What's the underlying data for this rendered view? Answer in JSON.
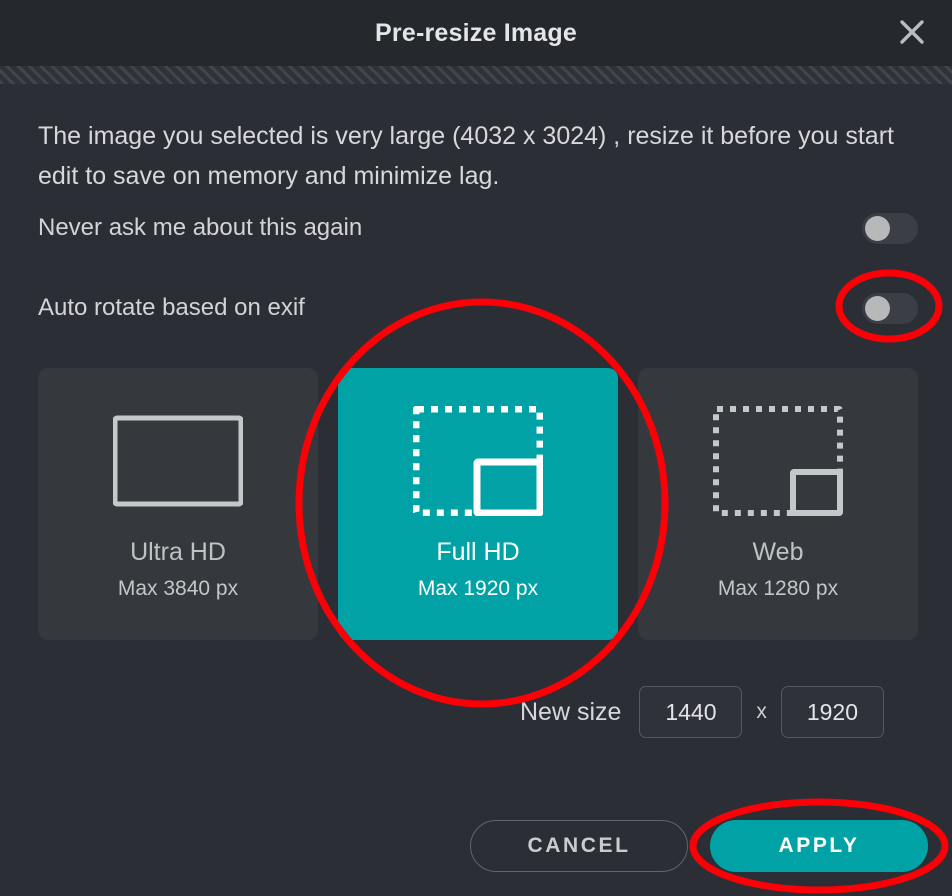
{
  "dialog": {
    "title": "Pre-resize Image",
    "close_icon": "close-icon",
    "description": "The image you selected is very large (4032 x 3024) , resize it before you start edit to save on memory and minimize lag."
  },
  "settings": [
    {
      "label": "Never ask me about this again",
      "state": "off"
    },
    {
      "label": "Auto rotate based on exif",
      "state": "off"
    }
  ],
  "presets": [
    {
      "title": "Ultra HD",
      "subtitle": "Max 3840 px",
      "icon": "solid-rectangle-icon",
      "selected": false
    },
    {
      "title": "Full HD",
      "subtitle": "Max 1920 px",
      "icon": "dashed-crop-rectangle-icon",
      "selected": true
    },
    {
      "title": "Web",
      "subtitle": "Max 1280 px",
      "icon": "dashed-crop-rectangle-small-icon",
      "selected": false
    }
  ],
  "new_size": {
    "label": "New size",
    "width_value": "1440",
    "height_value": "1920",
    "separator": "x"
  },
  "footer": {
    "cancel_label": "CANCEL",
    "apply_label": "APPLY"
  },
  "annotations": [
    {
      "name": "exif-toggle-highlight",
      "shape": "ellipse"
    },
    {
      "name": "full-hd-card-highlight",
      "shape": "circle"
    },
    {
      "name": "apply-button-highlight",
      "shape": "ellipse"
    }
  ],
  "colors": {
    "accent_teal": "#00a2a5",
    "annotation_red": "#fb0007",
    "page_bg": "#2b2e34",
    "card_bg": "#35383d",
    "titlebar_bg": "#25282d"
  }
}
